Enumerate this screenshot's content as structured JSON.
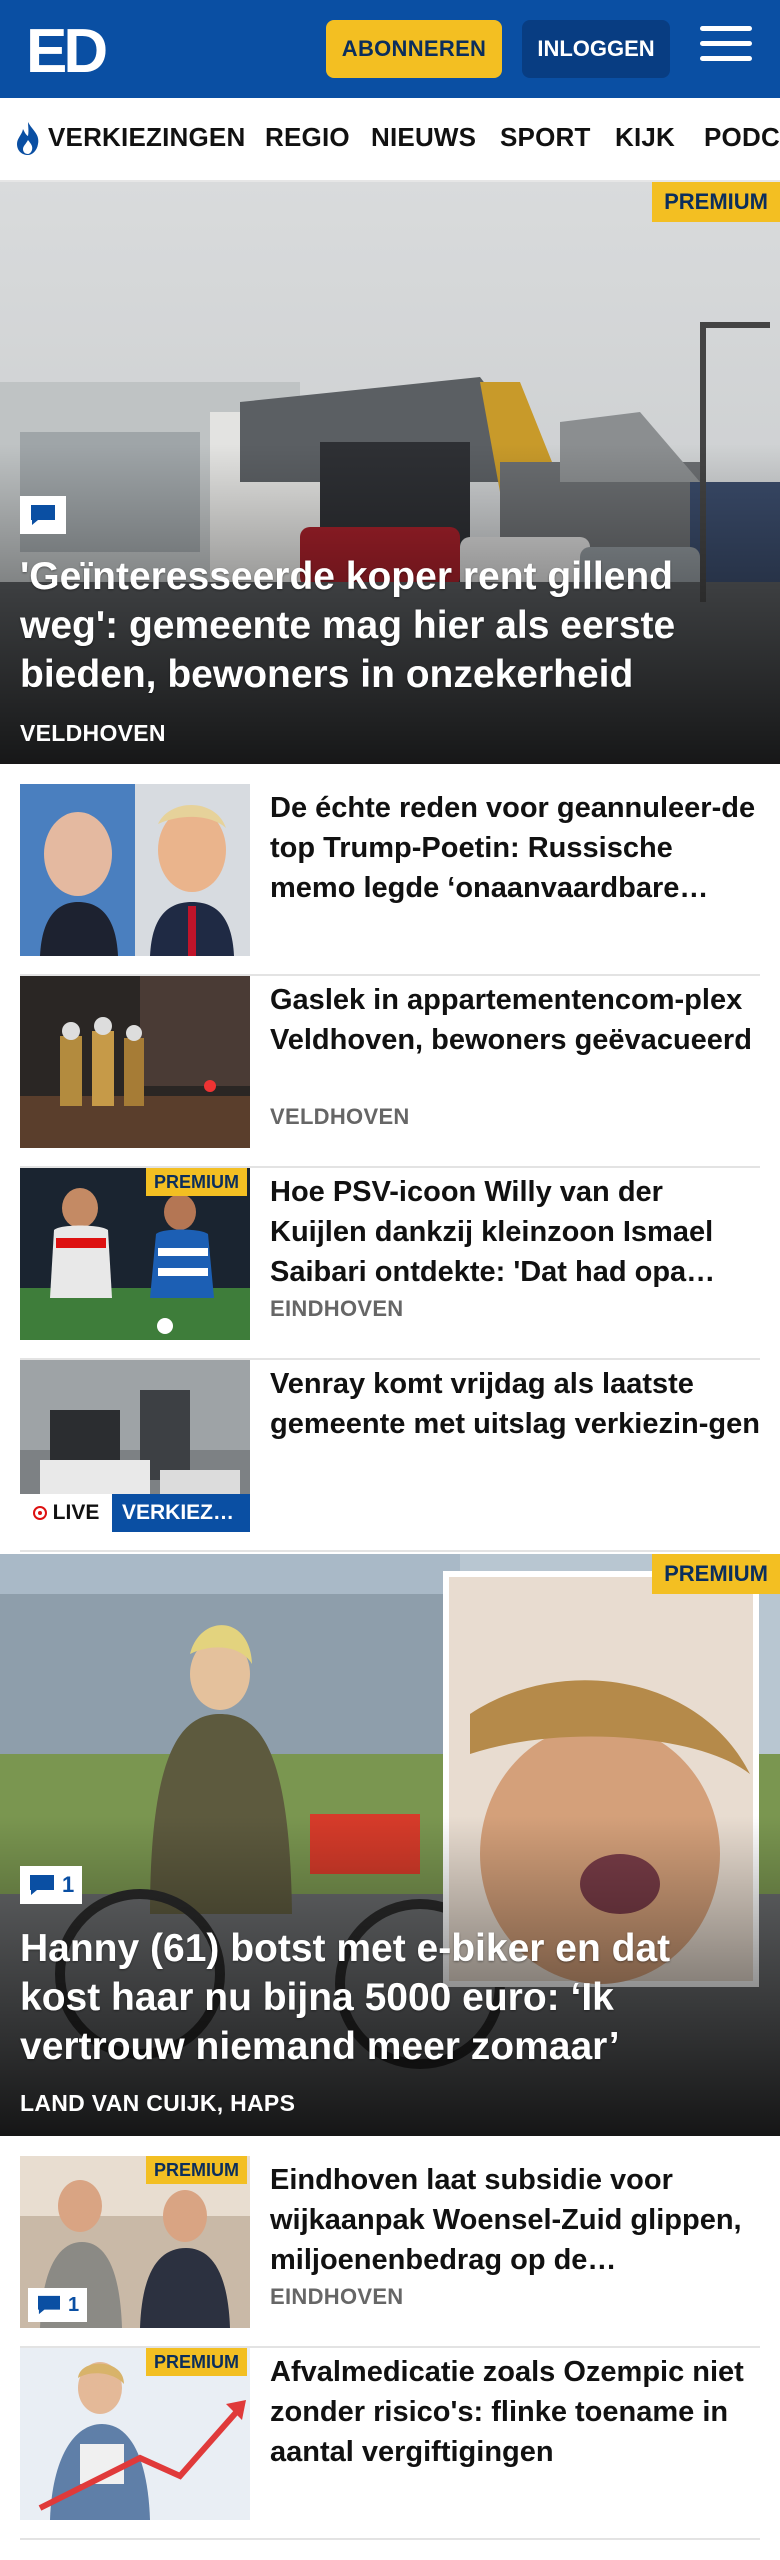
{
  "header": {
    "logo_text": "ED",
    "subscribe_label": "ABONNEREN",
    "login_label": "INLOGGEN"
  },
  "nav": {
    "items": [
      "VERKIEZINGEN",
      "REGIO",
      "NIEUWS",
      "SPORT",
      "KIJK",
      "PODC"
    ]
  },
  "hero1": {
    "premium": "PREMIUM",
    "title": "'Geïnteresseerde koper rent gillend weg': gemeente mag hier als eerste bieden, bewoners in onzekerheid",
    "location": "VELDHOVEN"
  },
  "list1": [
    {
      "title": "De échte reden voor geannuleer-de top Trump-Poetin: Russische memo legde ‘onaanvaardbare…",
      "location": ""
    },
    {
      "title": "Gaslek in appartementencom-plex Veldhoven, bewoners geëvacueerd",
      "location": "VELDHOVEN"
    },
    {
      "title": "Hoe PSV-icoon Willy van der Kuijlen dankzij kleinzoon Ismael Saibari ontdekte: 'Dat had opa…",
      "location": "EINDHOVEN",
      "premium": "PREMIUM"
    },
    {
      "title": "Venray komt vrijdag als laatste gemeente met uitslag verkiezin-gen",
      "location": "",
      "live": "LIVE",
      "tag": "VERKIEZ…"
    }
  ],
  "hero2": {
    "premium": "PREMIUM",
    "comments": "1",
    "title": "Hanny (61) botst met e-biker en dat kost haar nu bijna 5000 euro: ‘Ik vertrouw niemand meer zomaar’",
    "location": "LAND VAN CUIJK, HAPS"
  },
  "list2": [
    {
      "title": "Eindhoven laat subsidie voor wijkaanpak Woensel-Zuid glippen, miljoenenbedrag op de…",
      "location": "EINDHOVEN",
      "premium": "PREMIUM",
      "comments": "1"
    },
    {
      "title": "Afvalmedicatie zoals Ozempic niet zonder risico's: flinke toename in aantal vergiftigingen",
      "location": "",
      "premium": "PREMIUM"
    }
  ],
  "colors": {
    "brand_blue": "#0a4fa3",
    "premium_yellow": "#f3bf22"
  }
}
